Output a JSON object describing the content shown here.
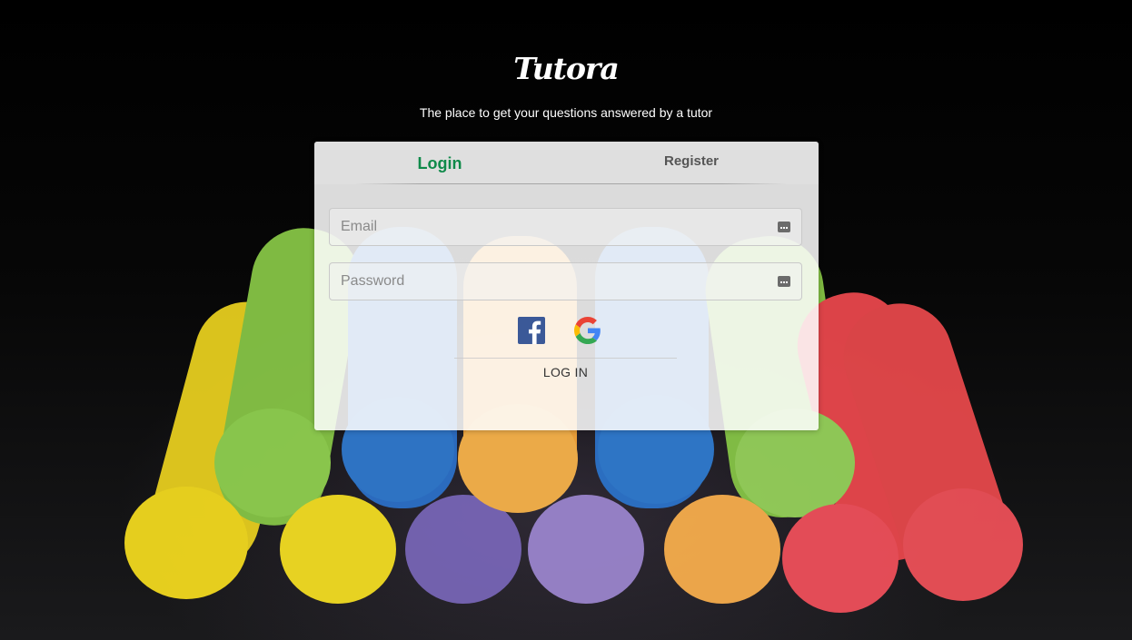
{
  "brand": {
    "name": "Tutora",
    "tagline": "The place to get your questions answered by a tutor"
  },
  "auth": {
    "tabs": {
      "login": "Login",
      "register": "Register"
    },
    "active_tab": "login",
    "email": {
      "placeholder": "Email",
      "value": ""
    },
    "password": {
      "placeholder": "Password",
      "value": ""
    },
    "social": [
      "facebook-icon",
      "google-icon"
    ],
    "submit_label": "LOG IN"
  },
  "colors": {
    "active_tab": "#0f8a4a",
    "facebook": "#3b5998",
    "google_blue": "#4285F4",
    "google_red": "#EA4335",
    "google_yellow": "#FBBC05",
    "google_green": "#34A853"
  },
  "background": "colorful chalk sticks on dark surface"
}
